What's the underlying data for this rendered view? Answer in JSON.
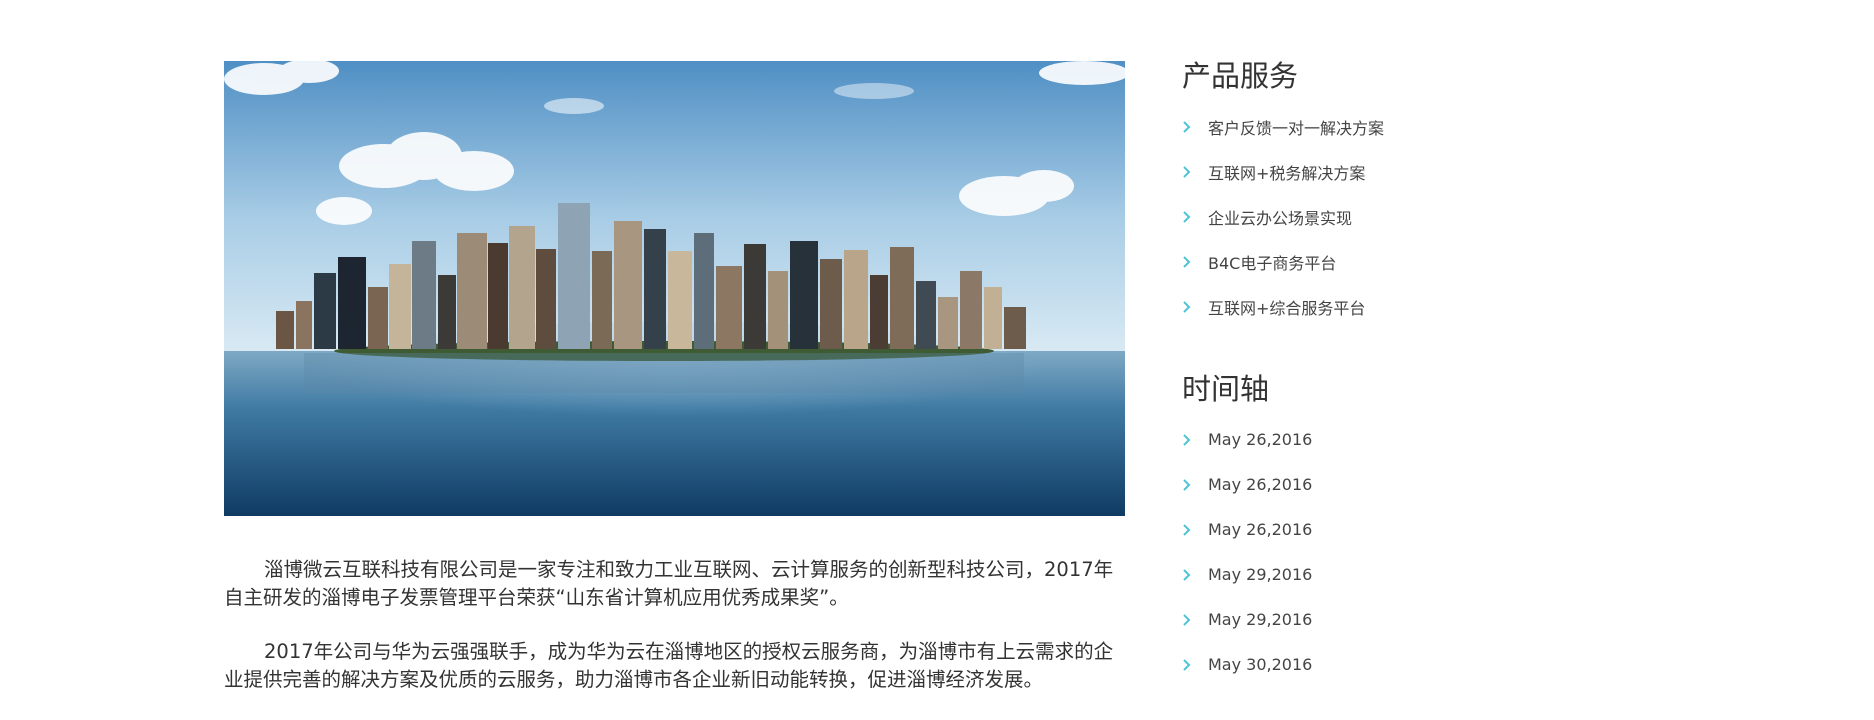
{
  "main_image": {
    "alt": "city-skyline-island"
  },
  "intro": {
    "paragraph_1": "淄博微云互联科技有限公司是一家专注和致力工业互联网、云计算服务的创新型科技公司，2017年自主研发的淄博电子发票管理平台荣获“山东省计算机应用优秀成果奖”。",
    "paragraph_2": "2017年公司与华为云强强联手，成为华为云在淄博地区的授权云服务商，为淄博市有上云需求的企业提供完善的解决方案及优质的云服务，助力淄博市各企业新旧动能转换，促进淄博经济发展。"
  },
  "sidebar": {
    "products": {
      "title": "产品服务",
      "items": [
        {
          "label": "客户反馈一对一解决方案"
        },
        {
          "label": "互联网+税务解决方案"
        },
        {
          "label": "企业云办公场景实现"
        },
        {
          "label": "B4C电子商务平台"
        },
        {
          "label": "互联网+综合服务平台"
        }
      ]
    },
    "timeline": {
      "title": "时间轴",
      "items": [
        {
          "label": "May 26,2016"
        },
        {
          "label": "May 26,2016"
        },
        {
          "label": "May 26,2016"
        },
        {
          "label": "May 29,2016"
        },
        {
          "label": "May 29,2016"
        },
        {
          "label": "May 30,2016"
        }
      ]
    }
  },
  "colors": {
    "accent": "#4fc3d6",
    "text": "#333333"
  }
}
